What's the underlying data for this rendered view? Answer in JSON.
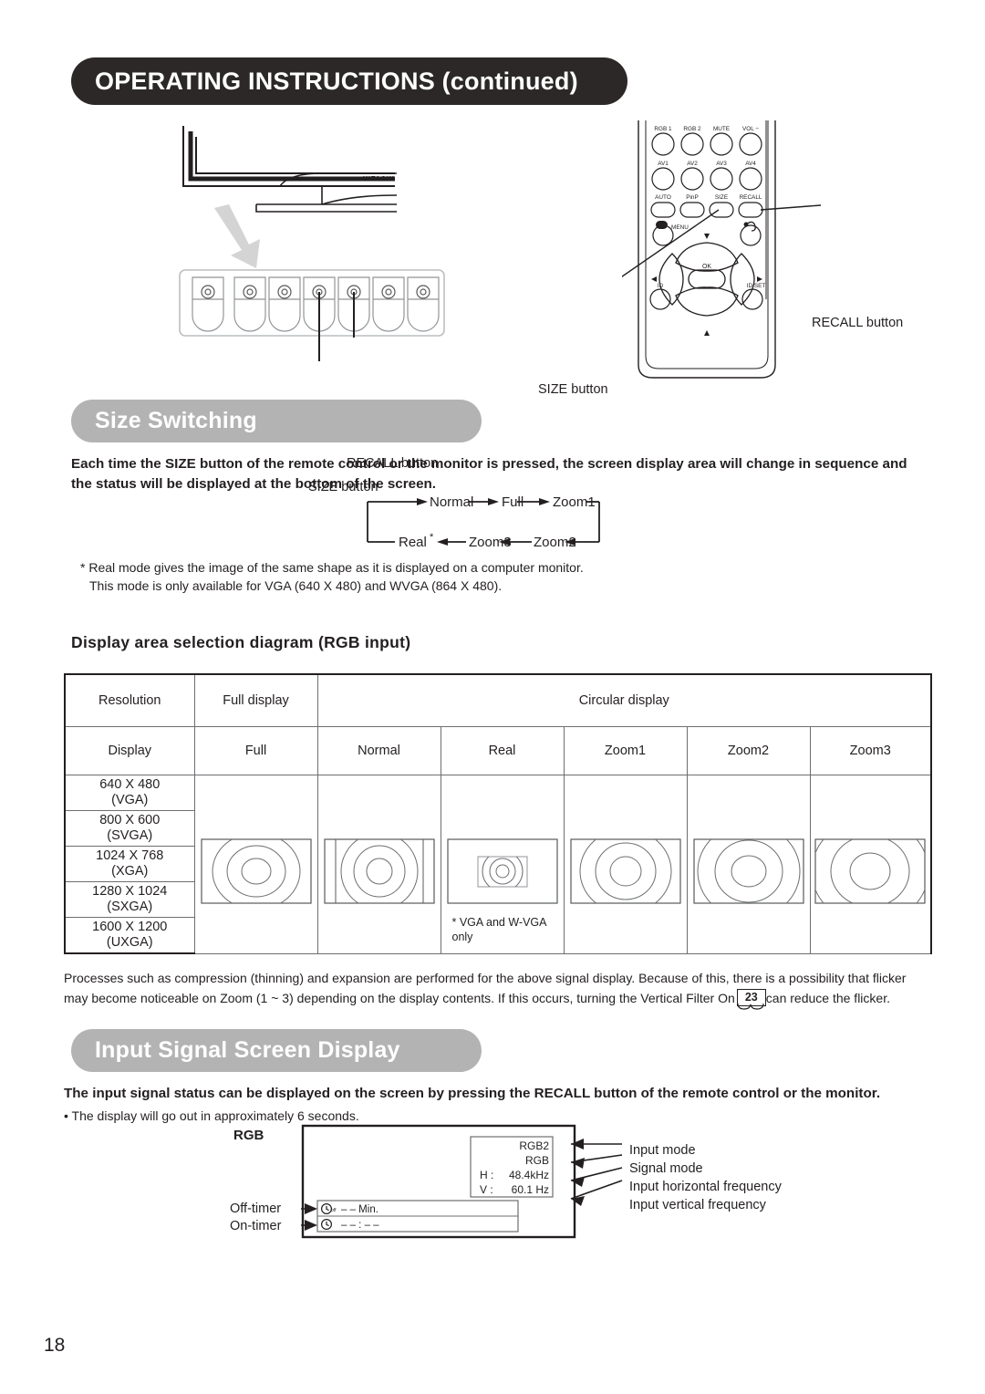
{
  "page": {
    "title": "OPERATING INSTRUCTIONS (continued)",
    "number": "18"
  },
  "top_illustration": {
    "brand_mark": "HITACHI",
    "monitor_callouts": {
      "recall": "RECALL button",
      "size": "SIZE button"
    },
    "remote_callouts": {
      "recall": "RECALL button",
      "size": "SIZE button"
    },
    "remote_buttons": {
      "row1": [
        "RGB 1",
        "RGB 2",
        "MUTE",
        "VOL −"
      ],
      "row2": [
        "AV1",
        "AV2",
        "AV3",
        "AV4"
      ],
      "row3": [
        "AUTO",
        "PinP",
        "SIZE",
        "RECALL"
      ],
      "menu": "MENU",
      "ok": "OK",
      "id": "ID",
      "id_set": "ID SET"
    }
  },
  "size_switching": {
    "banner": "Size Switching",
    "intro": "Each time the SIZE button of the remote control or the monitor is pressed, the screen display area will change in sequence and the status will be displayed at the bottom of the screen.",
    "cycle_top": [
      "Normal",
      "Full",
      "Zoom1"
    ],
    "cycle_bottom": [
      "Real",
      "Zoom3",
      "Zoom2"
    ],
    "real_asterisk": "*",
    "note_line1": "* Real mode gives the image of the same shape as it is displayed on a computer monitor.",
    "note_line2": "This mode is only available for VGA (640 X 480) and WVGA (864 X 480)."
  },
  "display_table": {
    "heading": "Display area selection diagram (RGB input)",
    "group_headers": {
      "resolution": "Resolution",
      "full_display": "Full display",
      "circular_display": "Circular display"
    },
    "column_headers": [
      "Display",
      "Full",
      "Normal",
      "Real",
      "Zoom1",
      "Zoom2",
      "Zoom3"
    ],
    "resolutions": [
      {
        "pixels": "640 X 480",
        "name": "(VGA)"
      },
      {
        "pixels": "800 X 600",
        "name": "(SVGA)"
      },
      {
        "pixels": "1024 X 768",
        "name": "(XGA)"
      },
      {
        "pixels": "1280 X 1024",
        "name": "(SXGA)"
      },
      {
        "pixels": "1600 X 1200",
        "name": "(UXGA)"
      }
    ],
    "real_footnote_line1": "* VGA and W-VGA",
    "real_footnote_line2": "only",
    "flicker_note_part1": "Processes such as compression (thinning) and expansion are performed for the above signal display. Because of this, there is a possibility that flicker may become noticeable on Zoom (1 ~ 3) depending on the display contents. If this occurs, turning the Vertical Filter On",
    "flicker_page_ref": "23",
    "flicker_note_part2": "can reduce the flicker."
  },
  "input_signal": {
    "banner": "Input Signal Screen Display",
    "intro": "The input signal status can be displayed on the screen by pressing the RECALL button of the remote control or the monitor.",
    "bullet": "• The display will go out in approximately 6 seconds.",
    "osd": {
      "source_label": "RGB",
      "input_mode_value": "RGB2",
      "signal_mode_value": "RGB",
      "h_label": "H :",
      "h_value": "48.4kHz",
      "v_label": "V :",
      "v_value": "60.1 Hz",
      "off_timer_value": "– – Min.",
      "on_timer_value": "– – : – –"
    },
    "left_labels": [
      "Off-timer",
      "On-timer"
    ],
    "right_labels": [
      "Input mode",
      "Signal mode",
      "Input horizontal frequency",
      "Input vertical frequency"
    ]
  },
  "colors": {
    "header_banner": "#2b2827",
    "section_banner": "#b3b3b3",
    "text": "#231f20",
    "rule": "#6d6e71"
  }
}
